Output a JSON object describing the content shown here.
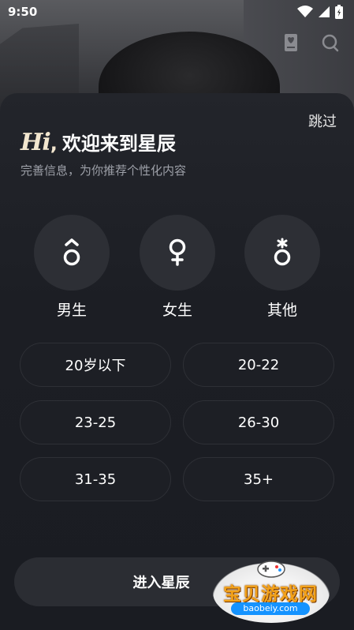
{
  "status": {
    "time": "9:50"
  },
  "skip_label": "跳过",
  "greeting": {
    "hi": "Hi",
    "comma": ",",
    "text": "欢迎来到星辰"
  },
  "subtitle": "完善信息，为你推荐个性化内容",
  "genders": [
    {
      "label": "男生",
      "icon": "male-icon"
    },
    {
      "label": "女生",
      "icon": "female-icon"
    },
    {
      "label": "其他",
      "icon": "other-gender-icon"
    }
  ],
  "ages": [
    "20岁以下",
    "20-22",
    "23-25",
    "26-30",
    "31-35",
    "35+"
  ],
  "enter_label": "进入星辰",
  "watermark": {
    "text": "宝贝游戏网",
    "domain": "baobeiy.com"
  },
  "colors": {
    "accent": "#f3e7cf",
    "sheet": "#1c1e24",
    "chip": "#2d2f35",
    "watermark": "#f3a21a"
  }
}
